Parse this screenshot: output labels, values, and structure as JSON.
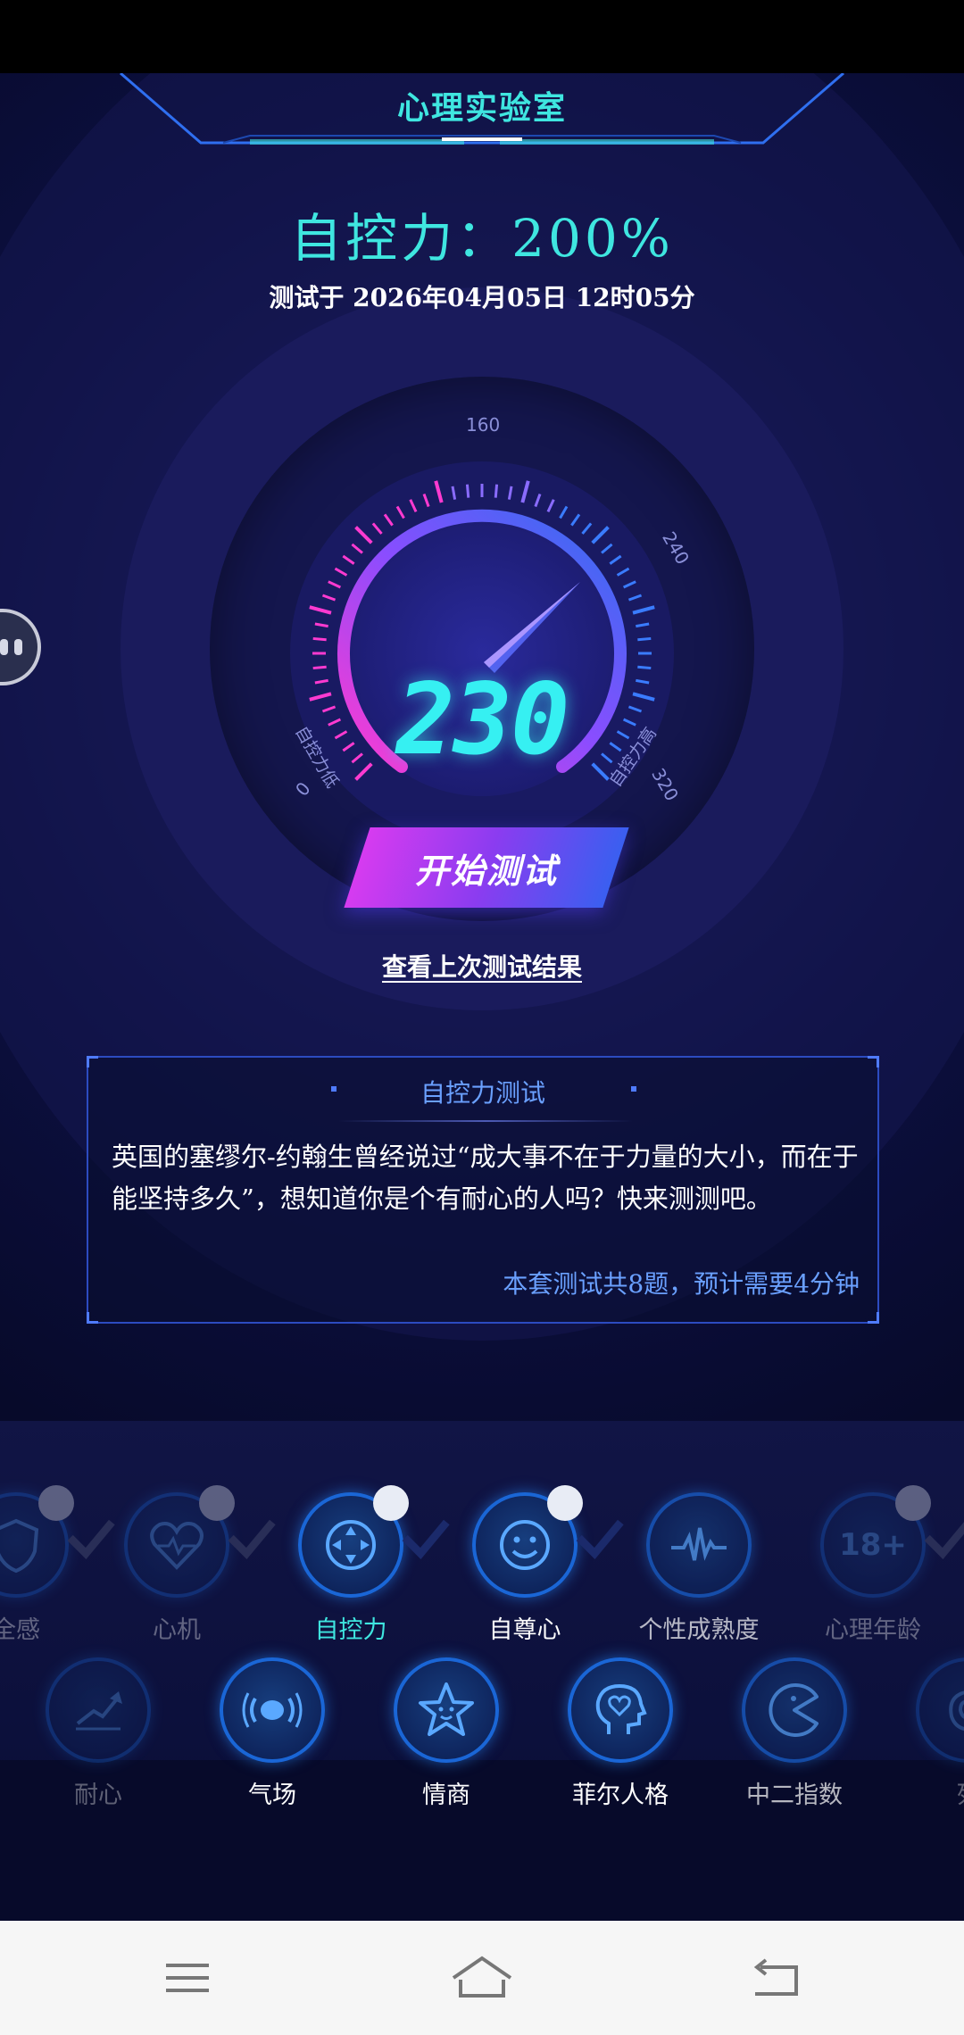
{
  "header": {
    "title": "心理实验室"
  },
  "result": {
    "title": "自控力：200%",
    "date": "测试于 2026年04月05日 12时05分"
  },
  "gauge": {
    "value": "230",
    "tick_top": "160",
    "tick_right": "240",
    "tick_left_num": "0",
    "tick_right_num": "320",
    "left_label": "自控力低",
    "right_label": "自控力高"
  },
  "actions": {
    "start_label": "开始测试",
    "last_result_label": "查看上次测试结果"
  },
  "info": {
    "title": "自控力测试",
    "description": "英国的塞缪尔-约翰生曾经说过“成大事不在于力量的大小，而在于能坚持多久”，想知道你是个有耐心的人吗？快来测测吧。",
    "footer": "本套测试共8题，预计需要4分钟"
  },
  "categories_row1": [
    {
      "label": "全感",
      "icon": "shield-icon",
      "checked": true
    },
    {
      "label": "心机",
      "icon": "heartbeat-icon",
      "checked": true
    },
    {
      "label": "自控力",
      "icon": "arrows-move-icon",
      "checked": true,
      "active": true
    },
    {
      "label": "自尊心",
      "icon": "smile-icon",
      "checked": true
    },
    {
      "label": "个性成熟度",
      "icon": "pulse-icon",
      "checked": false
    },
    {
      "label": "心理年龄",
      "icon": "age-18-icon",
      "checked": true
    }
  ],
  "categories_row2": [
    {
      "label": "耐心",
      "icon": "trend-icon"
    },
    {
      "label": "气场",
      "icon": "aura-icon"
    },
    {
      "label": "情商",
      "icon": "star-face-icon"
    },
    {
      "label": "菲尔人格",
      "icon": "head-heart-icon"
    },
    {
      "label": "中二指数",
      "icon": "pacman-icon"
    },
    {
      "label": "列",
      "icon": "spiral-icon"
    }
  ],
  "colors": {
    "accent": "#3fe6e0",
    "info": "#6aa0ff",
    "background": "#070a2a"
  }
}
